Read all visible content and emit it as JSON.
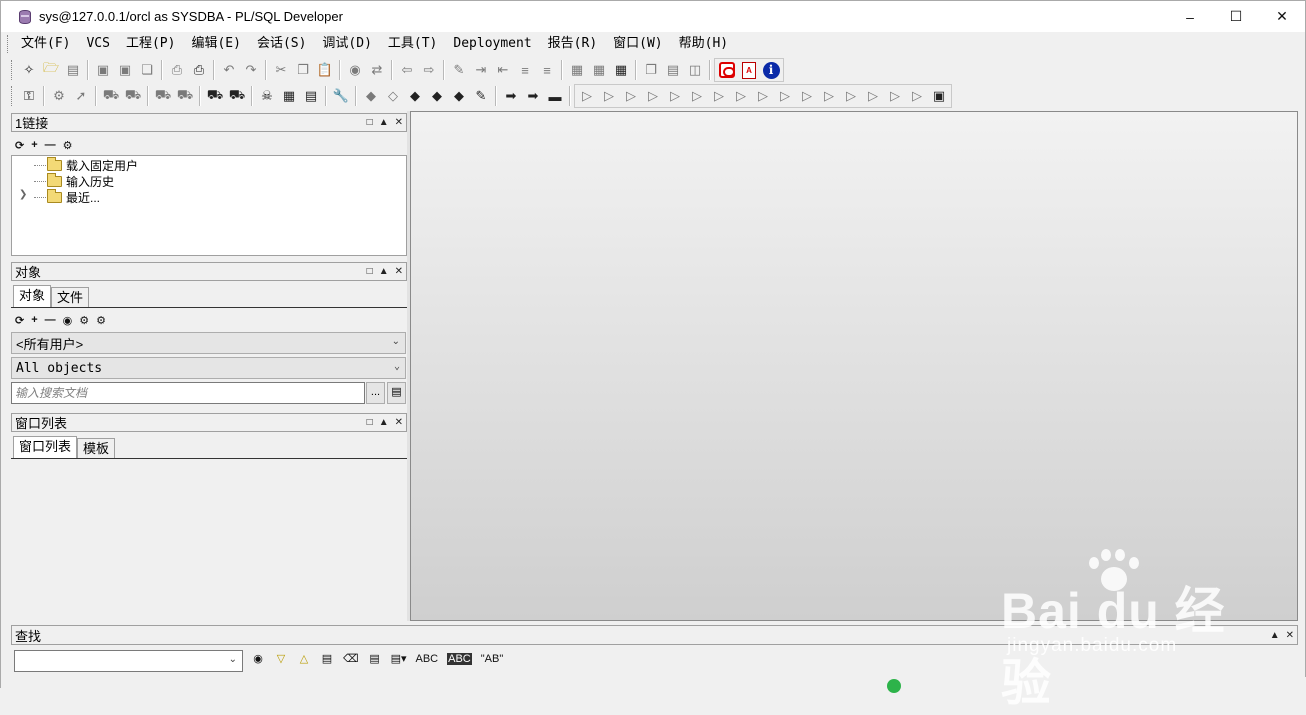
{
  "window": {
    "title": "sys@127.0.0.1/orcl as SYSDBA - PL/SQL Developer",
    "controls": [
      "minimize-icon",
      "maximize-icon",
      "close-icon"
    ]
  },
  "menu": [
    {
      "label": "文件(F)"
    },
    {
      "label": "VCS"
    },
    {
      "label": "工程(P)"
    },
    {
      "label": "编辑(E)"
    },
    {
      "label": "会话(S)"
    },
    {
      "label": "调试(D)"
    },
    {
      "label": "工具(T)"
    },
    {
      "label": "Deployment"
    },
    {
      "label": "报告(R)"
    },
    {
      "label": "窗口(W)"
    },
    {
      "label": "帮助(H)"
    }
  ],
  "connections_panel": {
    "title": "1链接",
    "tree": [
      {
        "label": "载入固定用户"
      },
      {
        "label": "输入历史"
      },
      {
        "label": "最近..."
      }
    ]
  },
  "objects_panel": {
    "title": "对象",
    "tabs": [
      "对象",
      "文件"
    ],
    "user_filter": "<所有用户>",
    "object_filter": "All objects",
    "search_placeholder": "输入搜索文档",
    "ellipsis_label": "..."
  },
  "window_list_panel": {
    "title": "窗口列表",
    "tabs": [
      "窗口列表",
      "模板"
    ]
  },
  "find_panel": {
    "title": "查找",
    "abc_label": "ABC",
    "abc_word_label": "ABC",
    "quoted_label": "\"AB\""
  },
  "watermark": {
    "logo": "Bai du 经验",
    "sub": "jingyan.baidu.com"
  }
}
